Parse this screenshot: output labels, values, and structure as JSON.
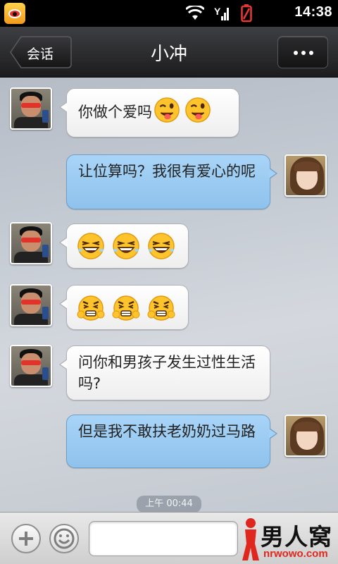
{
  "status_bar": {
    "time": "14:38",
    "battery_color": "#e53935"
  },
  "title_bar": {
    "back_label": "会话",
    "title": "小冲"
  },
  "messages": [
    {
      "direction": "in",
      "sender": "man",
      "text": "你做个爱吗",
      "emoji": [
        "wink-tongue-emoji",
        "wink-tongue-emoji"
      ]
    },
    {
      "direction": "out",
      "sender": "girl",
      "text": "让位算吗？我很有爱心的呢"
    },
    {
      "direction": "in",
      "sender": "man",
      "emoji": [
        "laugh-emoji",
        "laugh-emoji",
        "laugh-emoji"
      ]
    },
    {
      "direction": "in",
      "sender": "man",
      "emoji": [
        "grimace-emoji",
        "grimace-emoji",
        "grimace-emoji"
      ]
    },
    {
      "direction": "in",
      "sender": "man",
      "text": "问你和男孩子发生过性生活吗?"
    },
    {
      "direction": "out",
      "sender": "girl",
      "text": "但是我不敢扶老奶奶过马路"
    }
  ],
  "timestamp": "上午 00:44",
  "input": {
    "placeholder": ""
  },
  "watermark": {
    "brand": "男人窝",
    "url": "nrwowo.com"
  },
  "colors": {
    "incoming_bubble": "#ffffff",
    "outgoing_bubble": "#9ccbf2",
    "titlebar": "#2c2c2e"
  }
}
